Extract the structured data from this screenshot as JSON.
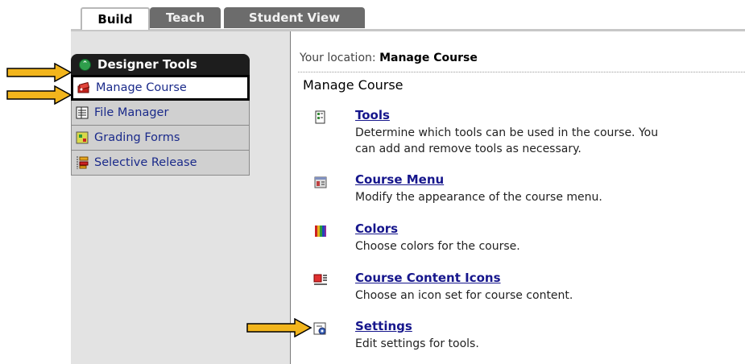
{
  "tabs": [
    {
      "label": "Build"
    },
    {
      "label": "Teach"
    },
    {
      "label": "Student View"
    }
  ],
  "designer_tools": {
    "title": "Designer Tools",
    "items": [
      {
        "label": "Manage Course",
        "icon": "manage-course-icon"
      },
      {
        "label": "File Manager",
        "icon": "file-manager-icon"
      },
      {
        "label": "Grading Forms",
        "icon": "grading-forms-icon"
      },
      {
        "label": "Selective Release",
        "icon": "selective-release-icon"
      }
    ]
  },
  "location": {
    "prefix": "Your location:",
    "current": "Manage Course"
  },
  "page_title": "Manage Course",
  "entries": [
    {
      "title": "Tools",
      "desc": [
        "Determine which tools can be used in the course. You",
        "can add and remove tools as necessary."
      ],
      "icon": "tools-icon"
    },
    {
      "title": "Course Menu",
      "desc": [
        "Modify the appearance of the course menu."
      ],
      "icon": "course-menu-icon"
    },
    {
      "title": "Colors",
      "desc": [
        "Choose colors for the course."
      ],
      "icon": "colors-icon"
    },
    {
      "title": "Course Content Icons",
      "desc": [
        "Choose an icon set for course content."
      ],
      "icon": "course-content-icons-icon"
    },
    {
      "title": "Settings",
      "desc": [
        "Edit settings for tools."
      ],
      "icon": "settings-icon"
    }
  ],
  "colors": {
    "arrow_fill": "#f2b51c",
    "link": "#16168c",
    "tab_inactive": "#6c6c6c"
  }
}
